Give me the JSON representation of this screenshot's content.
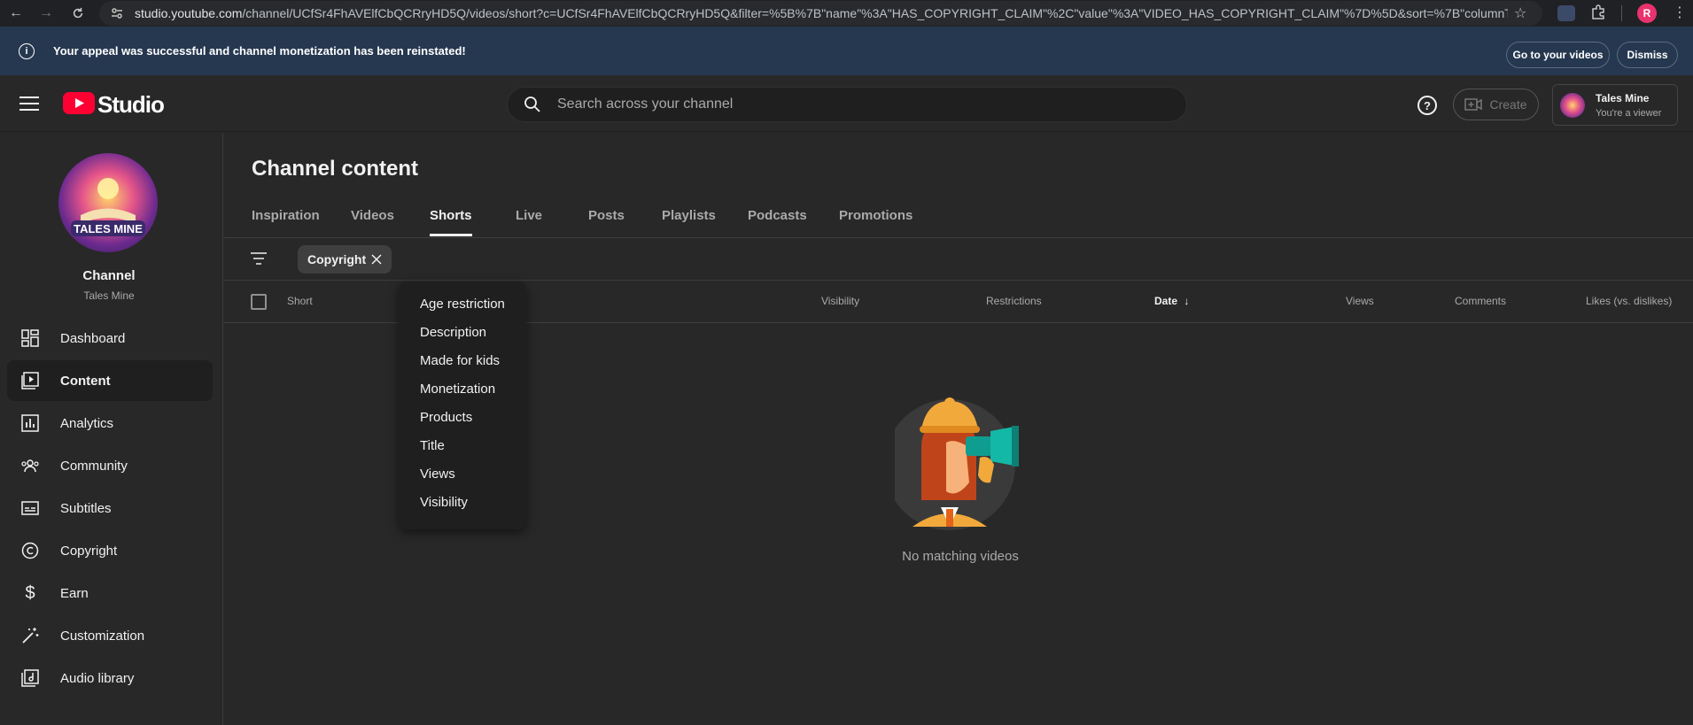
{
  "browser": {
    "url_host": "studio.youtube.com",
    "url_rest": "/channel/UCfSr4FhAVElfCbQCRryHD5Q/videos/short?c=UCfSr4FhAVElfCbQCRryHD5Q&filter=%5B%7B\"name\"%3A\"HAS_COPYRIGHT_CLAIM\"%2C\"value\"%3A\"VIDEO_HAS_COPYRIGHT_CLAIM\"%7D%5D&sort=%7B\"columnType\"%...",
    "profile_initial": "R"
  },
  "banner": {
    "message": "Your appeal was successful and channel monetization has been reinstated!",
    "go_button": "Go to your videos",
    "dismiss_button": "Dismiss"
  },
  "header": {
    "logo_text": "Studio",
    "search_placeholder": "Search across your channel",
    "create_label": "Create",
    "account_name": "Tales Mine",
    "account_role": "You're a viewer"
  },
  "sidebar": {
    "channel_title": "Channel",
    "channel_name": "Tales Mine",
    "items": [
      {
        "label": "Dashboard",
        "icon": "dashboard-icon"
      },
      {
        "label": "Content",
        "icon": "content-icon"
      },
      {
        "label": "Analytics",
        "icon": "analytics-icon"
      },
      {
        "label": "Community",
        "icon": "community-icon"
      },
      {
        "label": "Subtitles",
        "icon": "subtitles-icon"
      },
      {
        "label": "Copyright",
        "icon": "copyright-icon"
      },
      {
        "label": "Earn",
        "icon": "dollar-icon"
      },
      {
        "label": "Customization",
        "icon": "magic-wand-icon"
      },
      {
        "label": "Audio library",
        "icon": "audio-library-icon"
      }
    ],
    "active_item": "Content"
  },
  "main": {
    "title": "Channel content",
    "tabs": [
      "Inspiration",
      "Videos",
      "Shorts",
      "Live",
      "Posts",
      "Playlists",
      "Podcasts",
      "Promotions"
    ],
    "active_tab": "Shorts",
    "filter_chip": "Copyright",
    "columns": {
      "short": "Short",
      "visibility": "Visibility",
      "restrictions": "Restrictions",
      "date": "Date",
      "views": "Views",
      "comments": "Comments",
      "likes": "Likes (vs. dislikes)"
    },
    "empty_text": "No matching videos"
  },
  "dropdown": {
    "items": [
      "Age restriction",
      "Description",
      "Made for kids",
      "Monetization",
      "Products",
      "Title",
      "Views",
      "Visibility"
    ]
  },
  "colors": {
    "accent_red": "#ff0033",
    "banner_bg": "#263850",
    "background": "#282828"
  }
}
